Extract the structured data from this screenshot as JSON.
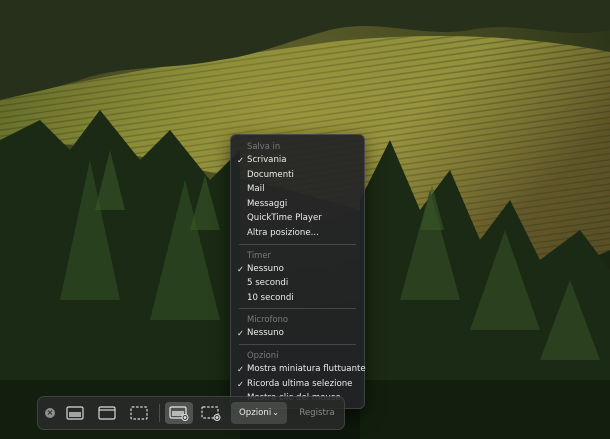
{
  "menu": {
    "sections": [
      {
        "header": "Salva in",
        "items": [
          {
            "label": "Scrivania",
            "checked": true
          },
          {
            "label": "Documenti",
            "checked": false
          },
          {
            "label": "Mail",
            "checked": false
          },
          {
            "label": "Messaggi",
            "checked": false
          },
          {
            "label": "QuickTime Player",
            "checked": false
          },
          {
            "label": "Altra posizione...",
            "checked": false
          }
        ]
      },
      {
        "header": "Timer",
        "items": [
          {
            "label": "Nessuno",
            "checked": true
          },
          {
            "label": "5 secondi",
            "checked": false
          },
          {
            "label": "10 secondi",
            "checked": false
          }
        ]
      },
      {
        "header": "Microfono",
        "items": [
          {
            "label": "Nessuno",
            "checked": true
          }
        ]
      },
      {
        "header": "Opzioni",
        "items": [
          {
            "label": "Mostra miniatura fluttuante",
            "checked": true
          },
          {
            "label": "Ricorda ultima selezione",
            "checked": true
          },
          {
            "label": "Mostra clic del mouse",
            "checked": false
          }
        ]
      }
    ],
    "check_glyph": "✓"
  },
  "toolbar": {
    "close_icon": "close-icon",
    "capture_tools": [
      {
        "name": "capture-entire-screen-icon",
        "selected": false
      },
      {
        "name": "capture-window-icon",
        "selected": false
      },
      {
        "name": "capture-selection-icon",
        "selected": false
      }
    ],
    "record_tools": [
      {
        "name": "record-entire-screen-icon",
        "selected": true
      },
      {
        "name": "record-selection-icon",
        "selected": false
      }
    ],
    "options_label": "Opzioni",
    "options_chevron": "⌄",
    "record_label": "Registra"
  },
  "colors": {
    "menu_bg": "#222426",
    "menu_text": "#ececec",
    "menu_header": "#77797c",
    "toolbar_bg": "#282a28"
  }
}
